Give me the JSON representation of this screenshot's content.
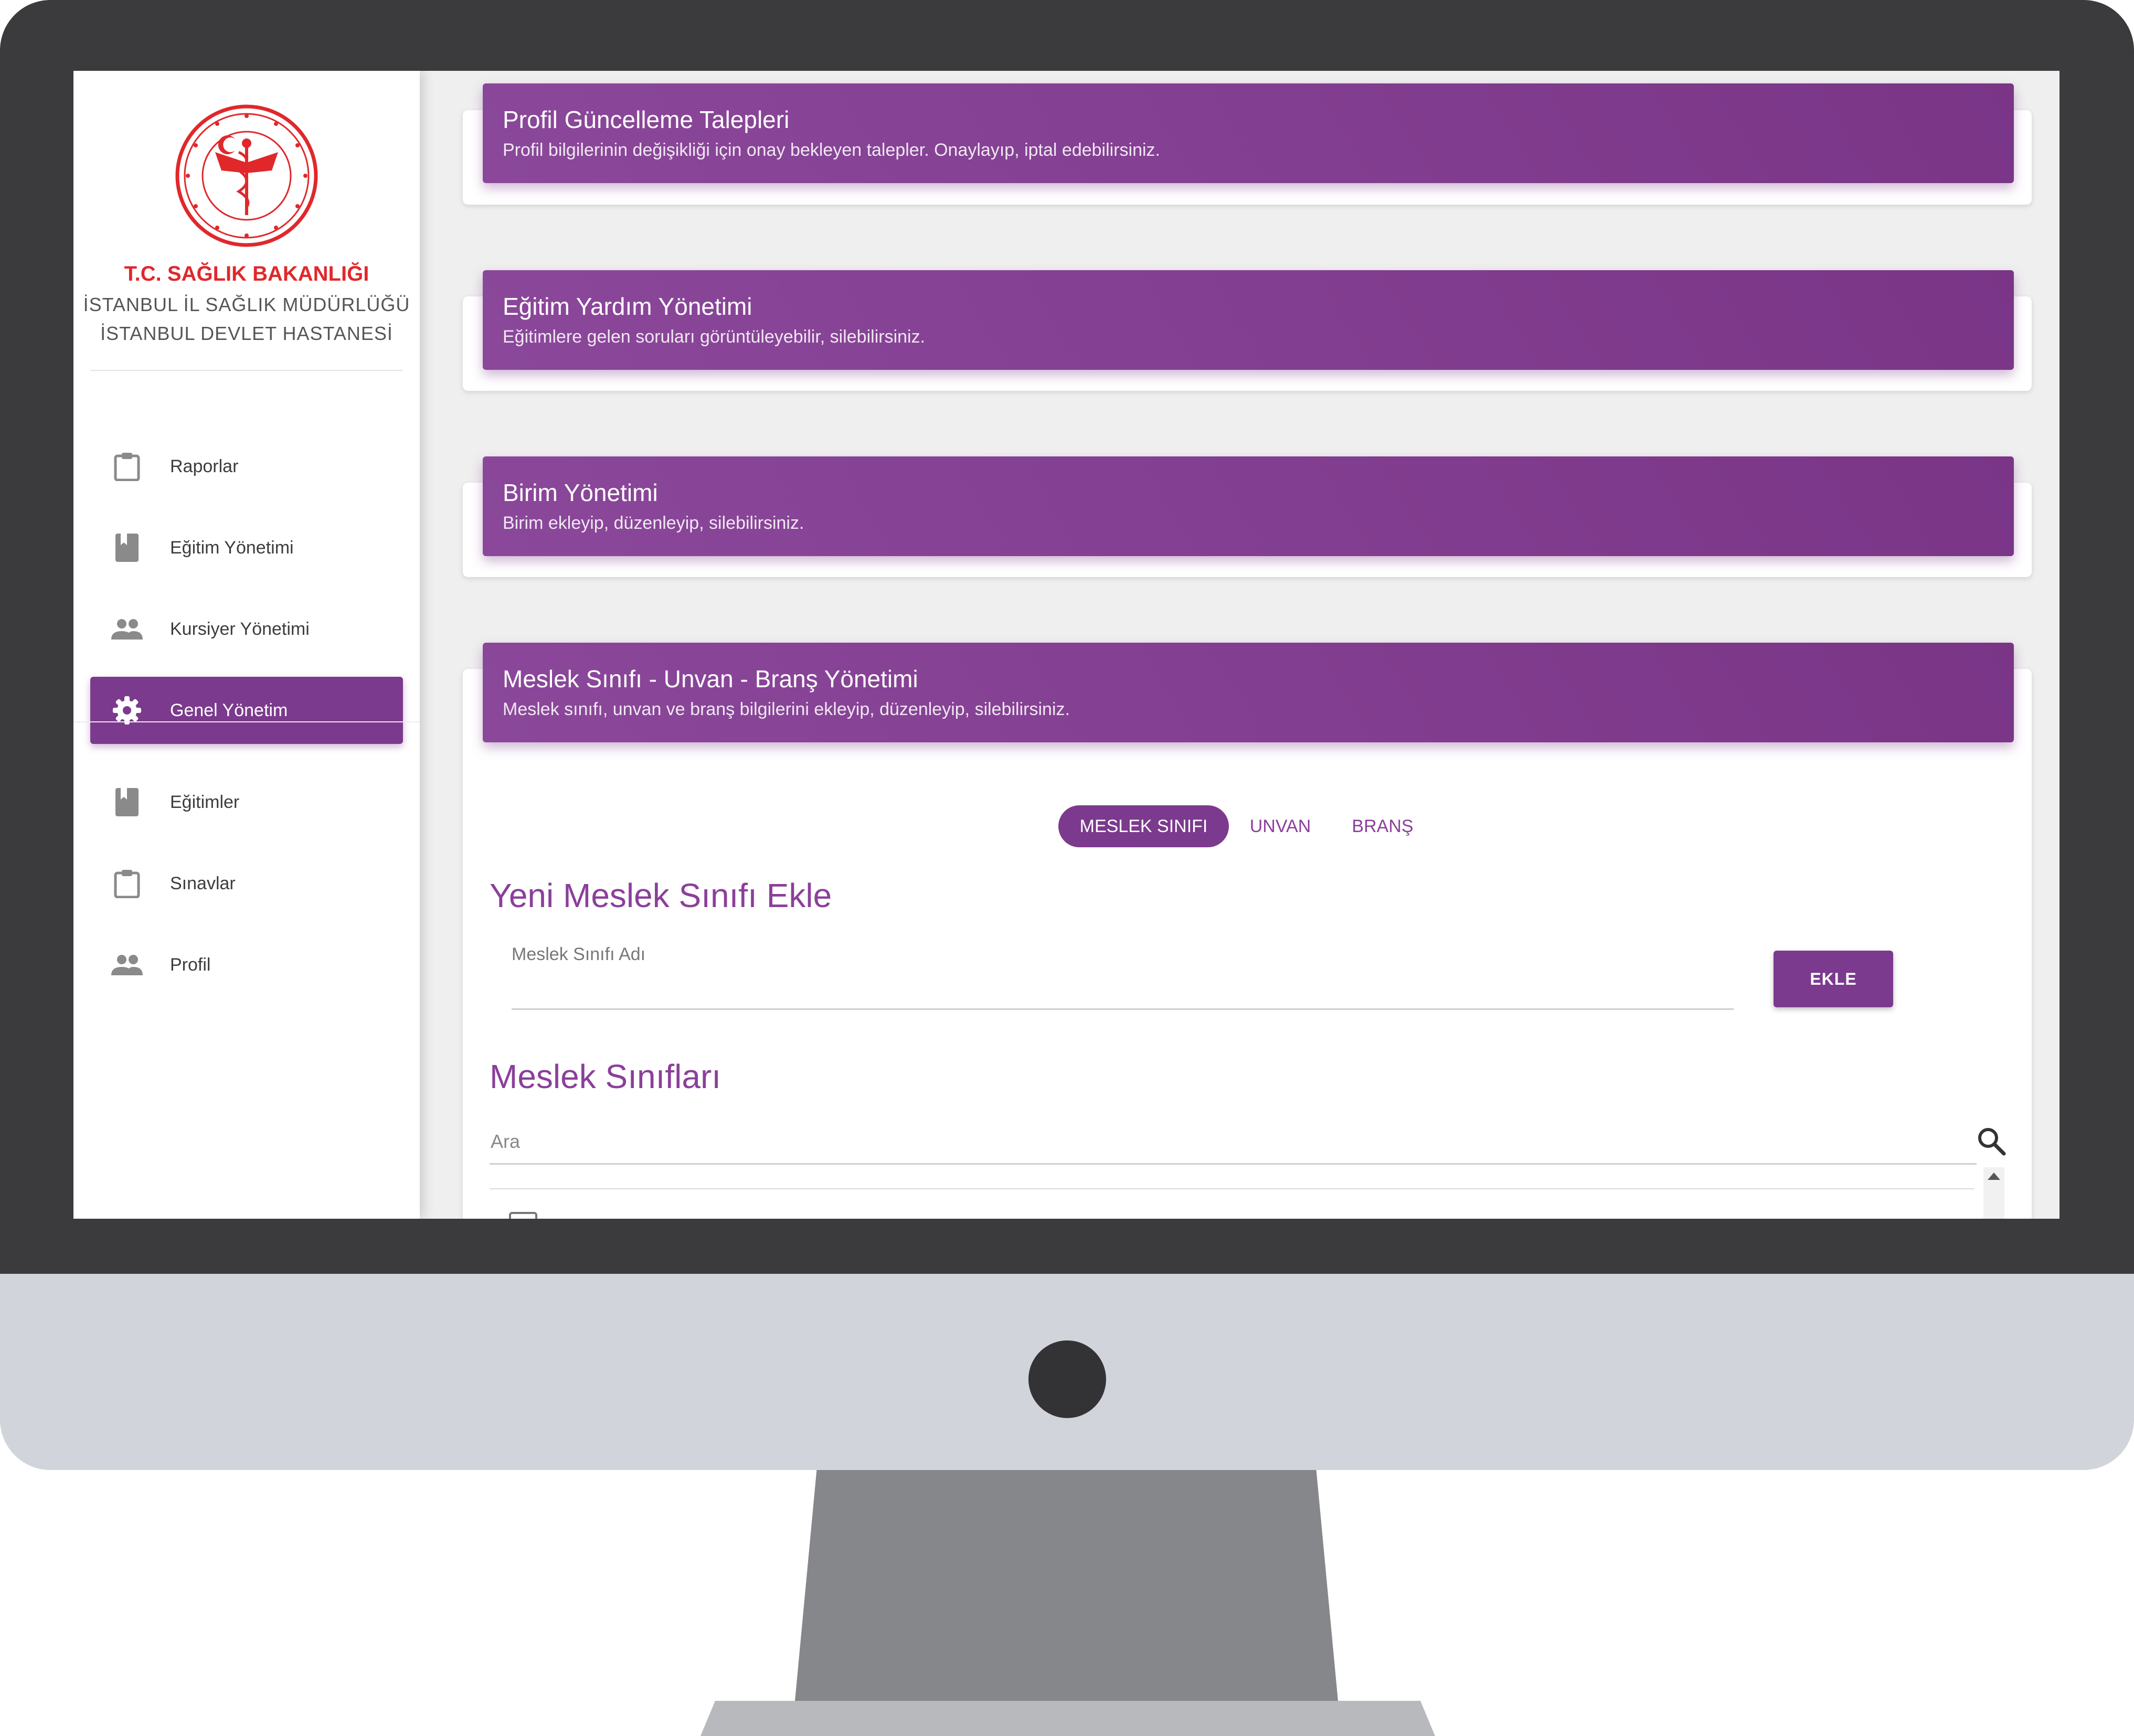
{
  "colors": {
    "primary": "#7b3a8d",
    "header_gradient": [
      "#8b489a",
      "#7a3587"
    ],
    "org_red": "#e0282b",
    "bezel": "#3b3b3d",
    "chin": "#d1d5db"
  },
  "sidebar": {
    "logo_icon": "ministry-of-health-seal-icon",
    "org_name": "T.C. SAĞLIK BAKANLIĞI",
    "org_sub1": "İSTANBUL İL SAĞLIK MÜDÜRLÜĞÜ",
    "org_sub2": "İSTANBUL DEVLET HASTANESİ",
    "items": [
      {
        "label": "Raporlar",
        "icon": "clipboard-icon",
        "active": false
      },
      {
        "label": "Eğitim Yönetimi",
        "icon": "book-icon",
        "active": false
      },
      {
        "label": "Kursiyer Yönetimi",
        "icon": "people-icon",
        "active": false
      },
      {
        "label": "Genel Yönetim",
        "icon": "gear-icon",
        "active": true
      },
      {
        "label": "Eğitimler",
        "icon": "book-icon",
        "active": false
      },
      {
        "label": "Sınavlar",
        "icon": "clipboard-icon",
        "active": false
      },
      {
        "label": "Profil",
        "icon": "people-icon",
        "active": false
      }
    ]
  },
  "cards": [
    {
      "title": "Profil Güncelleme Talepleri",
      "subtitle": "Profil bilgilerinin değişikliği için onay bekleyen talepler. Onaylayıp, iptal edebilirsiniz."
    },
    {
      "title": "Eğitim Yardım Yönetimi",
      "subtitle": "Eğitimlere gelen soruları görüntüleyebilir, silebilirsiniz."
    },
    {
      "title": "Birim Yönetimi",
      "subtitle": "Birim ekleyip, düzenleyip, silebilirsiniz."
    },
    {
      "title": "Meslek Sınıfı - Unvan - Branş Yönetimi",
      "subtitle": "Meslek sınıfı, unvan ve branş bilgilerini ekleyip, düzenleyip, silebilirsiniz."
    }
  ],
  "tabs": [
    {
      "label": "MESLEK SINIFI",
      "active": true
    },
    {
      "label": "UNVAN",
      "active": false
    },
    {
      "label": "BRANŞ",
      "active": false
    }
  ],
  "form": {
    "title": "Yeni Meslek Sınıfı Ekle",
    "field_label": "Meslek Sınıfı Adı",
    "field_value": "",
    "add_button": "EKLE"
  },
  "list": {
    "title": "Meslek Sınıfları",
    "search_placeholder": "Ara",
    "search_icon": "search-icon"
  }
}
